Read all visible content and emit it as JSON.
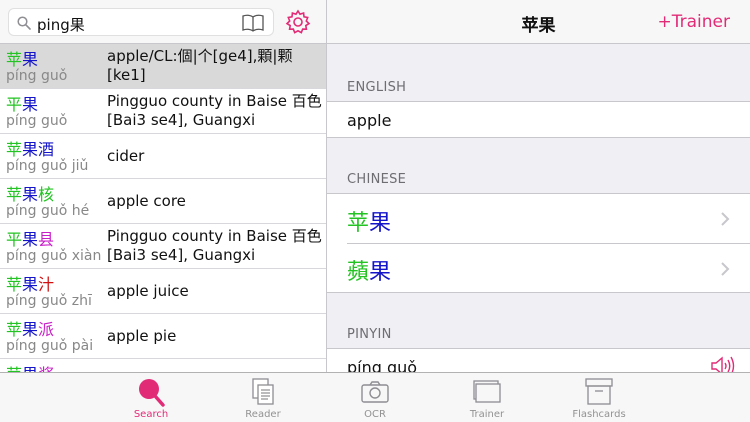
{
  "colors": {
    "accent": "#e22b77",
    "tone1": "#1a9c1a",
    "tone2": "#22c322",
    "tone3": "#1414c8",
    "tone4": "#c81ec8",
    "tone_red": "#d01010"
  },
  "search": {
    "query": "ping果"
  },
  "results": [
    {
      "chars": [
        {
          "c": "苹",
          "tone": "tone2"
        },
        {
          "c": "果",
          "tone": "tone3"
        }
      ],
      "pinyin": "píng guǒ",
      "definition": "apple/CL:個|个[ge4],顆|颗[ke1]",
      "selected": true
    },
    {
      "chars": [
        {
          "c": "平",
          "tone": "tone2"
        },
        {
          "c": "果",
          "tone": "tone3"
        }
      ],
      "pinyin": "píng guǒ",
      "definition": "Pingguo county in Baise 百色[Bai3 se4], Guangxi",
      "selected": false
    },
    {
      "chars": [
        {
          "c": "苹",
          "tone": "tone2"
        },
        {
          "c": "果",
          "tone": "tone3"
        },
        {
          "c": "酒",
          "tone": "tone3"
        }
      ],
      "pinyin": "píng guǒ jiǔ",
      "definition": "cider",
      "selected": false
    },
    {
      "chars": [
        {
          "c": "苹",
          "tone": "tone2"
        },
        {
          "c": "果",
          "tone": "tone3"
        },
        {
          "c": "核",
          "tone": "tone2"
        }
      ],
      "pinyin": "píng guǒ hé",
      "definition": "apple core",
      "selected": false
    },
    {
      "chars": [
        {
          "c": "平",
          "tone": "tone2"
        },
        {
          "c": "果",
          "tone": "tone3"
        },
        {
          "c": "县",
          "tone": "tone4"
        }
      ],
      "pinyin": "píng guǒ xiàn",
      "definition": "Pingguo county in Baise 百色[Bai3 se4], Guangxi",
      "selected": false
    },
    {
      "chars": [
        {
          "c": "苹",
          "tone": "tone2"
        },
        {
          "c": "果",
          "tone": "tone3"
        },
        {
          "c": "汁",
          "tone": "tone_red"
        }
      ],
      "pinyin": "píng guǒ zhī",
      "definition": "apple juice",
      "selected": false
    },
    {
      "chars": [
        {
          "c": "苹",
          "tone": "tone2"
        },
        {
          "c": "果",
          "tone": "tone3"
        },
        {
          "c": "派",
          "tone": "tone4"
        }
      ],
      "pinyin": "píng guǒ pài",
      "definition": "apple pie",
      "selected": false
    },
    {
      "chars": [
        {
          "c": "苹",
          "tone": "tone2"
        },
        {
          "c": "果",
          "tone": "tone3"
        },
        {
          "c": "酱",
          "tone": "tone4"
        }
      ],
      "pinyin": "",
      "definition": "",
      "selected": false
    }
  ],
  "detail": {
    "title": "苹果",
    "trainer_button": "+Trainer",
    "english_header": "ENGLISH",
    "english_value": "apple",
    "chinese_header": "CHINESE",
    "simplified": [
      {
        "c": "苹",
        "tone": "tone2"
      },
      {
        "c": "果",
        "tone": "tone3"
      }
    ],
    "traditional": [
      {
        "c": "蘋",
        "tone": "tone2"
      },
      {
        "c": "果",
        "tone": "tone3"
      }
    ],
    "pinyin_header": "PINYIN",
    "pinyin_value": "píng guǒ"
  },
  "tabs": [
    {
      "label": "Search",
      "icon": "search-icon",
      "active": true
    },
    {
      "label": "Reader",
      "icon": "reader-icon",
      "active": false
    },
    {
      "label": "OCR",
      "icon": "camera-icon",
      "active": false
    },
    {
      "label": "Trainer",
      "icon": "trainer-cards-icon",
      "active": false
    },
    {
      "label": "Flashcards",
      "icon": "flashcards-box-icon",
      "active": false
    }
  ]
}
